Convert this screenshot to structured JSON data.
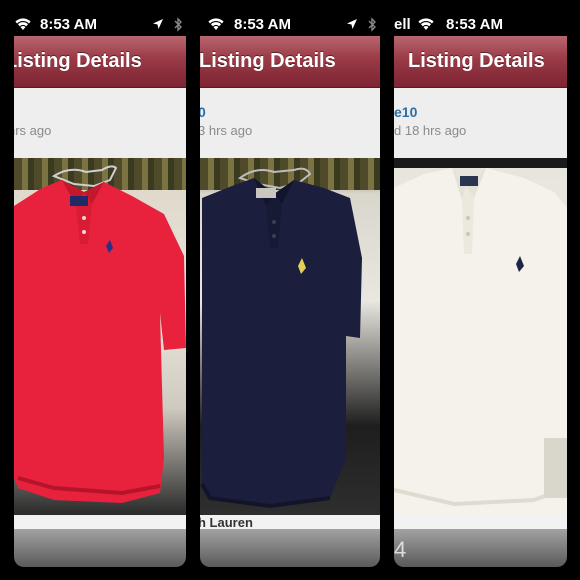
{
  "status_bar": {
    "time": "8:53 AM",
    "carrier_partial": "ell"
  },
  "nav": {
    "title": "Listing Details",
    "bar_color": "#9a3a46"
  },
  "listings": [
    {
      "seller": "",
      "posted": "hrs ago",
      "shirt_color": "#e8223c",
      "logo_color": "#2c2f8a",
      "caption": ""
    },
    {
      "seller": "0",
      "posted": "3 hrs ago",
      "shirt_color": "#1b1f3d",
      "logo_color": "#e3cf55",
      "caption": "h Lauren"
    },
    {
      "seller": "e10",
      "posted": "d 18 hrs ago",
      "shirt_color": "#f4f2ea",
      "logo_color": "#1d2744",
      "caption": "",
      "toolbar_count": "4"
    }
  ]
}
